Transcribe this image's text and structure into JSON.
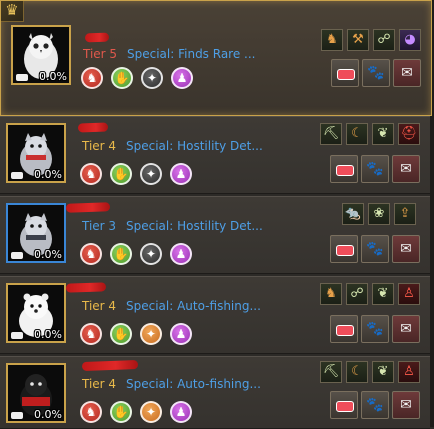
{
  "header_icon": "crown-icon",
  "pets": [
    {
      "tier": "Tier 5",
      "special": "Special: Finds Rare ...",
      "hunger": "0.0%",
      "portrait": "white-owl",
      "selected": true,
      "traits": [
        "horse-icon",
        "leaf-hand-icon",
        "compass-icon",
        "guard-icon"
      ],
      "skills": [
        "horseshoe-icon",
        "hammer-icon",
        "trap-icon",
        "purple-orb-icon"
      ]
    },
    {
      "tier": "Tier 4",
      "special": "Special: Hostility Det...",
      "hunger": "0.0%",
      "portrait": "armored-dog",
      "selected": false,
      "traits": [
        "horse-icon",
        "leaf-hand-icon",
        "compass-icon",
        "guard-icon"
      ],
      "skills": [
        "pickaxe-icon",
        "sickle-icon",
        "feather-icon",
        "helmet-icon"
      ]
    },
    {
      "tier": "Tier 3",
      "special": "Special: Hostility Det...",
      "hunger": "0.0%",
      "portrait": "armored-dog",
      "selected": false,
      "traits": [
        "horse-icon",
        "leaf-hand-icon",
        "compass-icon",
        "guard-icon"
      ],
      "skills": [
        "rat-icon",
        "leaf-icon",
        "buff-icon"
      ]
    },
    {
      "tier": "Tier 4",
      "special": "Special: Auto-fishing...",
      "hunger": "0.0%",
      "portrait": "white-bear-cub",
      "selected": false,
      "traits": [
        "horse-icon",
        "leaf-hand-icon",
        "compass-icon",
        "guard-icon"
      ],
      "skills": [
        "horseshoe-icon",
        "trap-icon",
        "feather-icon",
        "player-buff-icon"
      ]
    },
    {
      "tier": "Tier 4",
      "special": "Special: Auto-fishing...",
      "hunger": "0.0%",
      "portrait": "black-penguin",
      "selected": false,
      "traits": [
        "horse-icon",
        "leaf-hand-icon",
        "compass-icon",
        "guard-icon"
      ],
      "skills": [
        "pickaxe-icon",
        "sickle-icon",
        "feather-icon",
        "player-buff-icon"
      ]
    }
  ],
  "actions": [
    "feed-button",
    "paw-button",
    "bag-button"
  ]
}
